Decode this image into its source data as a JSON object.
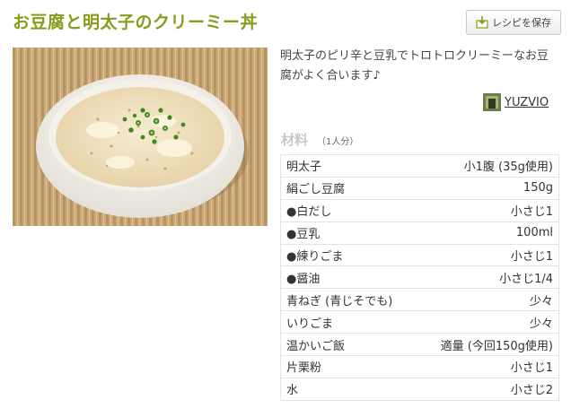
{
  "recipe": {
    "title": "お豆腐と明太子のクリーミー丼",
    "save_button": "レシピを保存",
    "description": "明太子のピリ辛と豆乳でトロトロクリーミーなお豆腐がよく合います♪",
    "author": "YUZVIO",
    "ingredients_heading": "材料",
    "servings": "（1人分）",
    "ingredients": [
      {
        "name": "明太子",
        "qty": "小1腹 (35g使用)"
      },
      {
        "name": "絹ごし豆腐",
        "qty": "150g"
      },
      {
        "name": "●白だし",
        "qty": "小さじ1"
      },
      {
        "name": "●豆乳",
        "qty": "100ml"
      },
      {
        "name": "●練りごま",
        "qty": "小さじ1"
      },
      {
        "name": "●醤油",
        "qty": "小さじ1/4"
      },
      {
        "name": "青ねぎ (青じそでも)",
        "qty": "少々"
      },
      {
        "name": "いりごま",
        "qty": "少々"
      },
      {
        "name": "温かいご飯",
        "qty": "適量 (今回150g使用)"
      },
      {
        "name": "片栗粉",
        "qty": "小さじ1"
      },
      {
        "name": "水",
        "qty": "小さじ2"
      }
    ]
  },
  "colors": {
    "title": "#8a9a1b",
    "placemat": "#d9b98a",
    "bowl": "#f7f5ef",
    "scallion": "#3f8a1e"
  }
}
